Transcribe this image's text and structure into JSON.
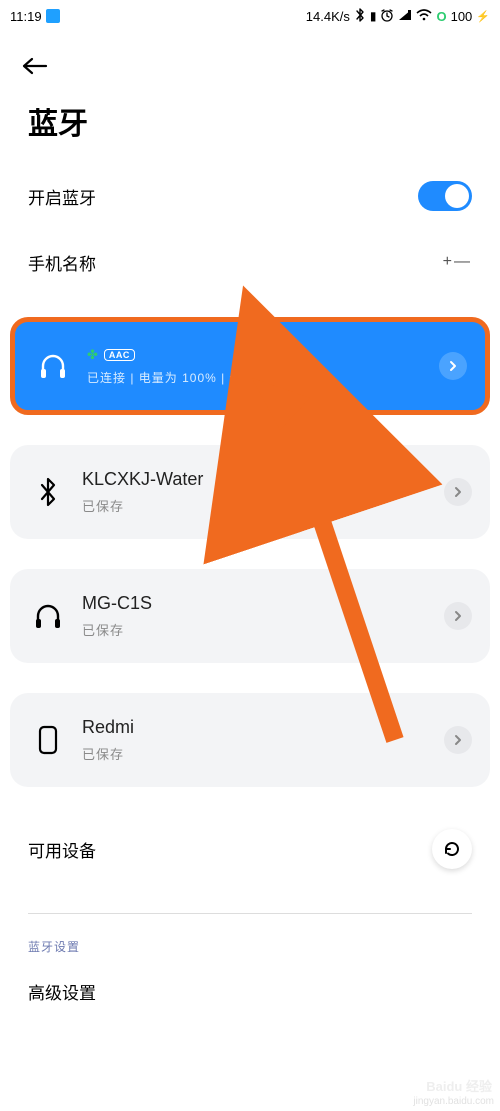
{
  "status": {
    "time": "11:19",
    "net_rate": "14.4K/s",
    "battery_text": "100"
  },
  "page": {
    "title": "蓝牙"
  },
  "toggle_row": {
    "label": "开启蓝牙",
    "on": true
  },
  "name_row": {
    "label": "手机名称",
    "value": "+—"
  },
  "devices": [
    {
      "name": "",
      "codec": "AAC",
      "sub": "已连接 | 电量为 100% | 使用中",
      "icon": "headphones",
      "connected": true
    },
    {
      "name": "KLCXKJ-Water",
      "sub": "已保存",
      "icon": "bluetooth",
      "connected": false
    },
    {
      "name": "MG-C1S",
      "sub": "已保存",
      "icon": "headphones",
      "connected": false
    },
    {
      "name": "Redmi",
      "sub": "已保存",
      "icon": "phone",
      "connected": false
    }
  ],
  "available": {
    "label": "可用设备"
  },
  "section": {
    "label": "蓝牙设置",
    "advanced": "高级设置"
  },
  "watermark": {
    "brand": "Baidu 经验",
    "url": "jingyan.baidu.com"
  }
}
